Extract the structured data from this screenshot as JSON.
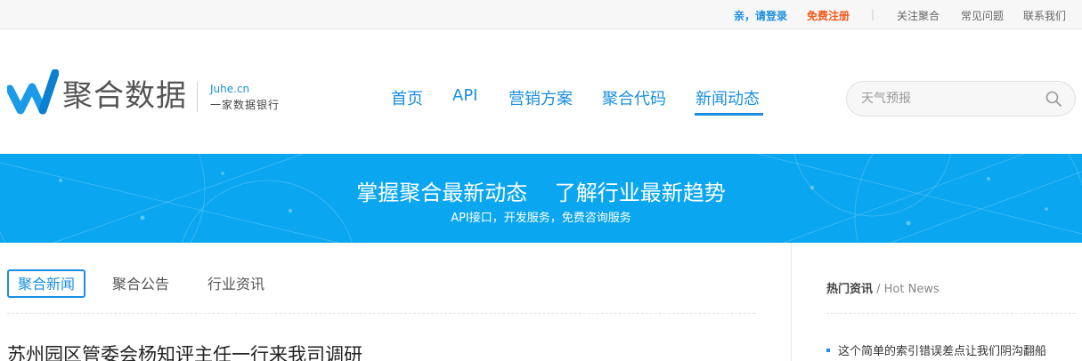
{
  "topbar": {
    "login": "亲，请登录",
    "register": "免费注册",
    "separator": "|",
    "follow": "关注聚合",
    "faq": "常见问题",
    "contact": "联系我们"
  },
  "header": {
    "logo_name": "聚合数据",
    "logo_domain": "Juhe.cn",
    "logo_slogan": "一家数据银行",
    "nav": {
      "home": "首页",
      "api": "API",
      "marketing": "营销方案",
      "code": "聚合代码",
      "news": "新闻动态"
    },
    "search_placeholder": "天气预报"
  },
  "banner": {
    "title": "掌握聚合最新动态    了解行业最新趋势",
    "subtitle": "API接口，开发服务，免费咨询服务"
  },
  "tabs": {
    "active": "聚合新闻",
    "second": "聚合公告",
    "third": "行业资讯"
  },
  "article": {
    "title": "苏州园区管委会杨知评主任一行来我司调研"
  },
  "hot_news": {
    "title_cn": "热门资讯",
    "title_en": " / Hot News",
    "items": [
      "这个简单的索引错误差点让我们阴沟翻船"
    ]
  },
  "colors": {
    "brand_blue": "#1a8fe0",
    "banner_blue": "#0aa6f0",
    "register_orange": "#f05a1a"
  }
}
